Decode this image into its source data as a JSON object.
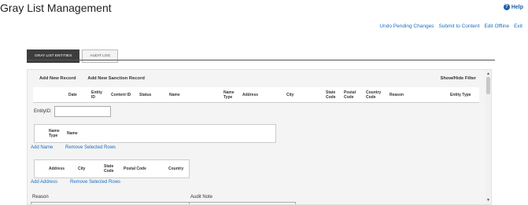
{
  "page_title": "Gray List Management",
  "help_label": "Help",
  "top_links": [
    "Undo Pending Changes",
    "Submit to Content",
    "Edit Offline",
    "Exit"
  ],
  "tabs": [
    {
      "label": "GRAY LIST ENTITIES",
      "active": true
    },
    {
      "label": "AUDIT LOG",
      "active": false
    }
  ],
  "toolbar": {
    "add_new_record": "Add New Record",
    "add_new_sanction_record": "Add New Sanction Record",
    "show_hide_filter": "Show/Hide Filter"
  },
  "grid_columns": [
    "Date",
    "Entity ID",
    "Content ID",
    "Status",
    "Name",
    "Name Type",
    "Address",
    "City",
    "State Code",
    "Postal Code",
    "Country Code",
    "Reason",
    "Entity Type"
  ],
  "entity_id_label": "EntityID:",
  "names_table": {
    "columns": [
      "Name Type",
      "Name"
    ],
    "add_link": "Add Name",
    "remove_link": "Remove Selected Rows"
  },
  "address_table": {
    "columns": [
      "Address",
      "City",
      "State Code",
      "Postal Code",
      "Country"
    ],
    "add_link": "Add Address",
    "remove_link": "Remove Selected Rows"
  },
  "reason_label": "Reason",
  "audit_note_label": "Audit Note",
  "colors": {
    "link": "#1a6ec1",
    "active_tab": "#3d3d3d"
  }
}
